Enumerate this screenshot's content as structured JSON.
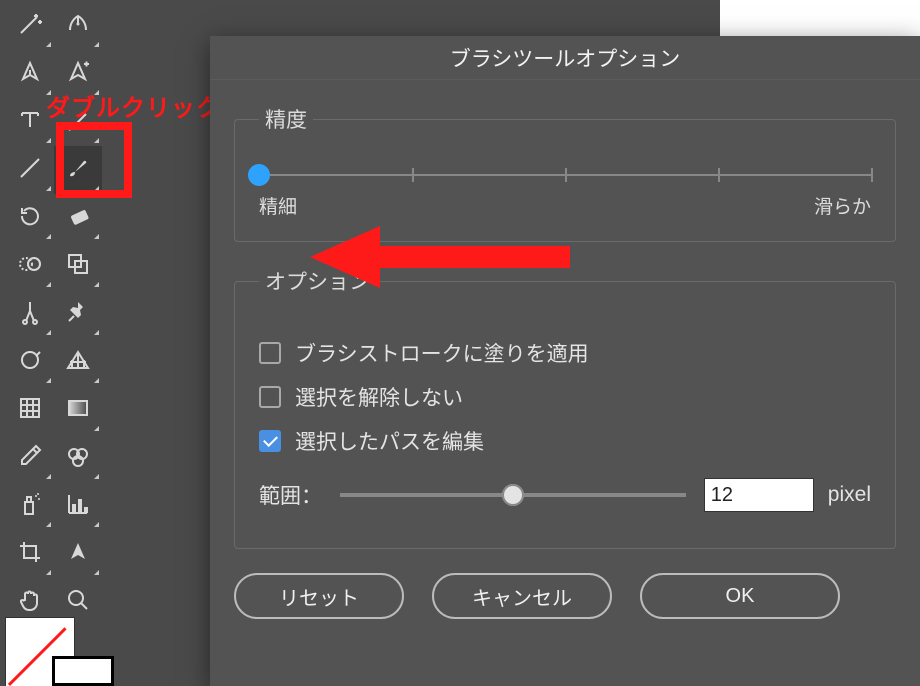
{
  "annotation": {
    "label": "ダブルクリック"
  },
  "dialog": {
    "title": "ブラシツールオプション",
    "fidelity": {
      "legend": "精度",
      "min_label": "精細",
      "max_label": "滑らか",
      "ticks": 5,
      "value": 0
    },
    "options": {
      "legend": "オプション",
      "fill_new_strokes": {
        "label": "ブラシストロークに塗りを適用",
        "checked": false
      },
      "keep_selected": {
        "label": "選択を解除しない",
        "checked": false
      },
      "edit_selected": {
        "label": "選択したパスを編集",
        "checked": true
      },
      "range": {
        "label": "範囲：",
        "value": "12",
        "unit": "pixel",
        "pos": 50
      }
    },
    "buttons": {
      "reset": "リセット",
      "cancel": "キャンセル",
      "ok": "OK"
    }
  },
  "colors": {
    "accent": "#2ea2ff",
    "annot": "#ff1a1a"
  },
  "tool_icons": [
    "magic-wand-icon",
    "curvature-pen-icon",
    "pen-icon",
    "anchor-point-icon",
    "type-icon",
    "touch-type-icon",
    "line-segment-icon",
    "brush-icon",
    "rotate-icon",
    "eraser-icon",
    "blend-icon",
    "shape-builder-icon",
    "scissors-icon",
    "pin-icon",
    "lasso-icon",
    "perspective-grid-icon",
    "mesh-icon",
    "gradient-icon",
    "eyedropper-icon",
    "swatch-icon",
    "spray-icon",
    "column-graph-icon",
    "crop-icon",
    "knife-icon",
    "hand-icon",
    "zoom-icon"
  ]
}
